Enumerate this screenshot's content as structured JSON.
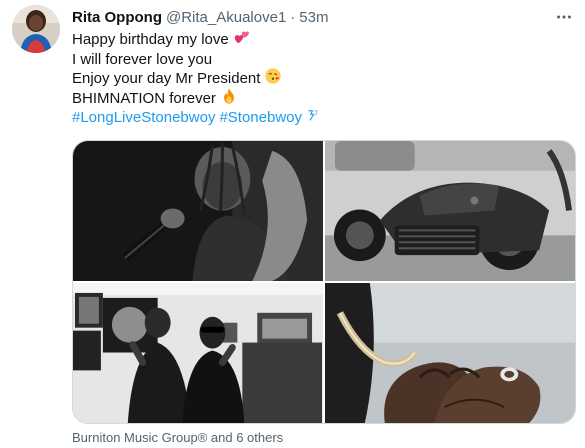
{
  "tweet": {
    "author_name": "Rita Oppong",
    "author_handle": "@Rita_Akualove1",
    "separator": "·",
    "time": "53m",
    "lines": [
      "Happy birthday my love",
      "I will forever love you",
      "Enjoy your day Mr President",
      "BHIMNATION forever"
    ],
    "hashtags": [
      "#LongLiveStonebwoy",
      "#Stonebwoy"
    ],
    "footer": "Burniton Music Group® and 6 others"
  },
  "colors": {
    "link": "#1d9bf0",
    "secondary_text": "#536471",
    "border": "#cfd9de"
  },
  "icons": {
    "more": "more-dots-icon",
    "line1": "two-hearts-icon",
    "line3": "face-blowing-kiss-icon",
    "line4": "fire-icon",
    "hashtag_badge": "stonebwoy-hashflag-icon"
  },
  "media": {
    "count": 4,
    "images": [
      "singer-with-microphone-photo",
      "motorcycle-vehicle-photo",
      "studio-group-photo",
      "hands-closeup-photo"
    ]
  }
}
